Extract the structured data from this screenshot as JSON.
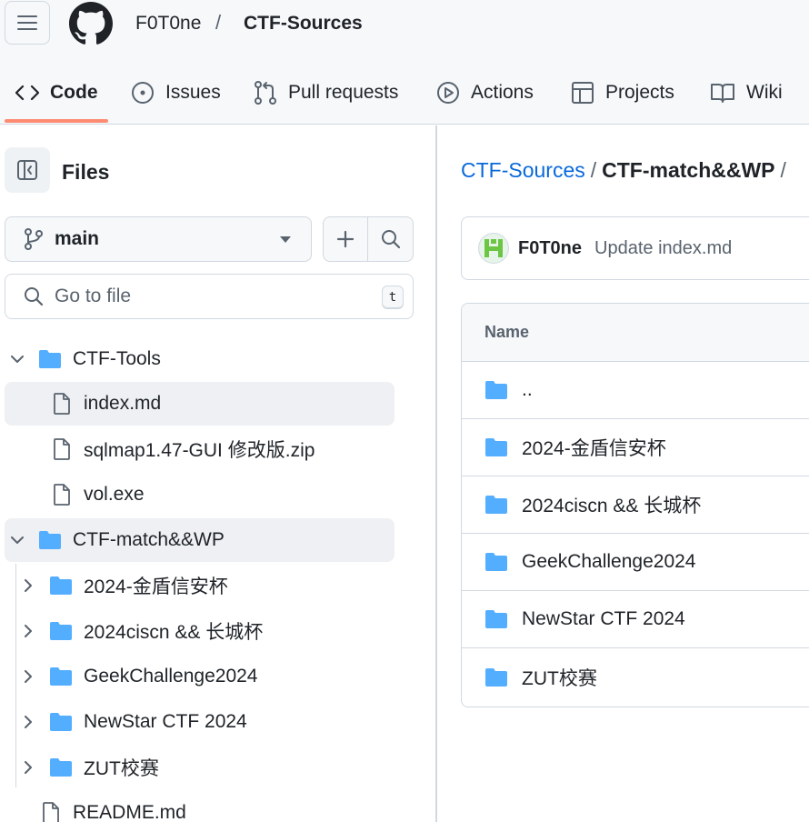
{
  "header": {
    "owner": "F0T0ne",
    "separator": "/",
    "repo": "CTF-Sources"
  },
  "tabs": [
    {
      "label": "Code",
      "icon": "code-icon",
      "active": true
    },
    {
      "label": "Issues",
      "icon": "issue-icon"
    },
    {
      "label": "Pull requests",
      "icon": "pull-request-icon"
    },
    {
      "label": "Actions",
      "icon": "play-icon"
    },
    {
      "label": "Projects",
      "icon": "table-icon"
    },
    {
      "label": "Wiki",
      "icon": "book-icon"
    }
  ],
  "sidebar": {
    "title": "Files",
    "branch": "main",
    "goto_placeholder": "Go to file",
    "goto_shortcut": "t",
    "tree": [
      {
        "label": "CTF-Tools",
        "type": "folder",
        "expanded": true
      },
      {
        "label": "index.md",
        "type": "file"
      },
      {
        "label": "sqlmap1.47-GUI 修改版.zip",
        "type": "file"
      },
      {
        "label": "vol.exe",
        "type": "file"
      },
      {
        "label": "CTF-match&&WP",
        "type": "folder",
        "expanded": true
      },
      {
        "label": "2024-金盾信安杯",
        "type": "folder"
      },
      {
        "label": "2024ciscn && 长城杯",
        "type": "folder"
      },
      {
        "label": "GeekChallenge2024",
        "type": "folder"
      },
      {
        "label": "NewStar CTF 2024",
        "type": "folder"
      },
      {
        "label": "ZUT校赛",
        "type": "folder"
      },
      {
        "label": "README.md",
        "type": "file"
      }
    ]
  },
  "main": {
    "breadcrumb": {
      "repo": "CTF-Sources",
      "sep": "/",
      "current": "CTF-match&&WP",
      "trail": "/"
    },
    "commit": {
      "author": "F0T0ne",
      "message": "Update index.md"
    },
    "table": {
      "header": "Name",
      "rows": [
        {
          "name": ".."
        },
        {
          "name": "2024-金盾信安杯"
        },
        {
          "name": "2024ciscn && 长城杯"
        },
        {
          "name": "GeekChallenge2024"
        },
        {
          "name": "NewStar CTF 2024"
        },
        {
          "name": "ZUT校赛"
        }
      ]
    }
  },
  "colors": {
    "accent": "#0969da",
    "folder": "#54aeff",
    "tab_underline": "#fd8c73",
    "border": "#d1d9e0"
  }
}
